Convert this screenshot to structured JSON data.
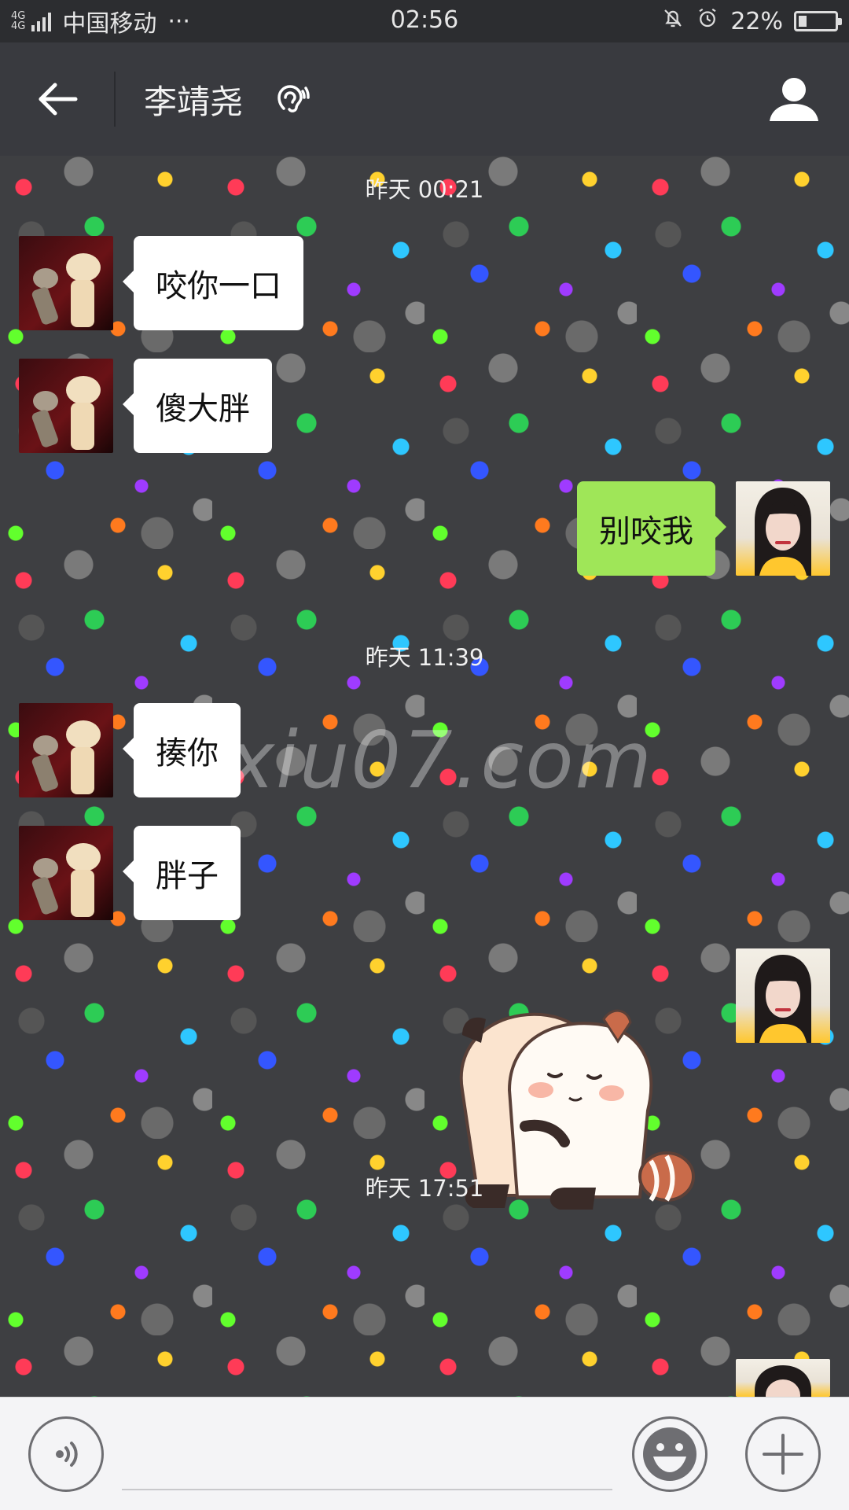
{
  "status_bar": {
    "network_type": "4G",
    "network_type_2": "4G",
    "carrier": "中国移动",
    "more": "···",
    "time": "02:56",
    "battery": "22%",
    "battery_level": 0.22,
    "icons": [
      "signal-icon",
      "bell-off-icon",
      "alarm-icon",
      "battery-icon"
    ]
  },
  "nav": {
    "back_icon": "arrow-left-icon",
    "title": "李靖尧",
    "ear_icon": "ear-icon",
    "profile_icon": "person-icon"
  },
  "chat": {
    "watermark": "xiu07.com",
    "timestamps": [
      "昨天 00:21",
      "昨天 11:39",
      "昨天 17:51"
    ],
    "messages": [
      {
        "from": "other",
        "text": "咬你一口"
      },
      {
        "from": "other",
        "text": "傻大胖"
      },
      {
        "from": "me",
        "text": "别咬我"
      },
      {
        "from": "other",
        "text": "揍你"
      },
      {
        "from": "other",
        "text": "胖子"
      },
      {
        "from": "me",
        "type": "sticker",
        "sticker": "hugging-panda-sticker"
      }
    ]
  },
  "input_bar": {
    "voice_icon": "voice-icon",
    "text_value": "",
    "emoji_icon": "smiley-icon",
    "plus_icon": "plus-icon"
  }
}
